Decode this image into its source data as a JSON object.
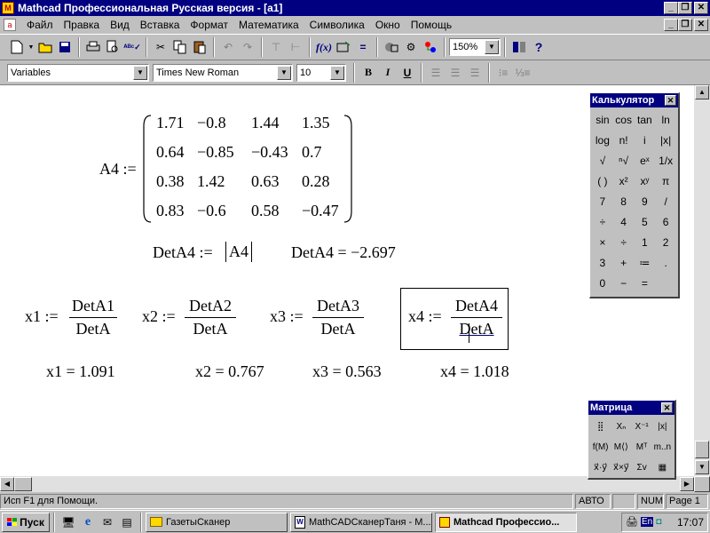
{
  "window": {
    "title": "Mathcad Профессиональная Русская версия - [a1]",
    "app_icon": "mathcad-logo-icon",
    "buttons": [
      "_",
      "❐",
      "✕"
    ],
    "doc_buttons": [
      "_",
      "❐",
      "✕"
    ]
  },
  "menu": [
    "Файл",
    "Правка",
    "Вид",
    "Вставка",
    "Формат",
    "Математика",
    "Символика",
    "Окно",
    "Помощь"
  ],
  "toolbar": {
    "zoom": "150%"
  },
  "format_bar": {
    "style": "Variables",
    "font": "Times New Roman",
    "size": "10",
    "bold": "B",
    "italic": "I",
    "underline": "U"
  },
  "worksheet": {
    "a4_label": "A4 :=",
    "a4_rows": [
      [
        "1.71",
        "−0.8",
        "1.44",
        "1.35"
      ],
      [
        "0.64",
        "−0.85",
        "−0.43",
        "0.7"
      ],
      [
        "0.38",
        "1.42",
        "0.63",
        "0.28"
      ],
      [
        "0.83",
        "−0.6",
        "0.58",
        "−0.47"
      ]
    ],
    "det_def_label": "DetA4 :=",
    "det_def_arg": "A4",
    "det_result": "DetA4 = −2.697",
    "fractions": [
      {
        "lhs": "x1 :=",
        "num": "DetA1",
        "den": "DetA"
      },
      {
        "lhs": "x2 :=",
        "num": "DetA2",
        "den": "DetA"
      },
      {
        "lhs": "x3 :=",
        "num": "DetA3",
        "den": "DetA"
      },
      {
        "lhs": "x4 :=",
        "num": "DetA4",
        "den": "DetA"
      }
    ],
    "results": [
      "x1 = 1.091",
      "x2 = 0.767",
      "x3 = 0.563",
      "x4 = 1.018"
    ]
  },
  "calculator": {
    "title": "Калькулятор",
    "close": "✕",
    "keys": [
      "sin",
      "cos",
      "tan",
      "ln",
      "log",
      "n!",
      "i",
      "|x|",
      "√",
      "ⁿ√",
      "eˣ",
      "1/x",
      "( )",
      "x²",
      "xʸ",
      "π",
      "7",
      "8",
      "9",
      "/",
      "÷",
      "4",
      "5",
      "6",
      "×",
      "÷",
      "1",
      "2",
      "3",
      "+",
      "≔",
      ".",
      "0",
      "−",
      "=",
      ""
    ]
  },
  "matrix_palette": {
    "title": "Матрица",
    "close": "✕",
    "keys": [
      "⣿",
      "Xₙ",
      "X⁻¹",
      "|x|",
      "f(M)",
      "M⟨⟩",
      "Mᵀ",
      "m..n",
      "x⃗·y⃗",
      "x⃗×y⃗",
      "Σv",
      "▦"
    ]
  },
  "status": {
    "hint": "Исп F1 для Помощи.",
    "mode": "АВТО",
    "num": "NUM",
    "page": "Page 1"
  },
  "taskbar": {
    "start": "Пуск",
    "tasks": [
      "ГазетыСканер",
      "MathCADСканерТаня - M...",
      "Mathcad Профессио..."
    ],
    "lang": "En",
    "clock": "17:07"
  },
  "colors": {
    "title_bg": "#000080",
    "face": "#c0c0c0",
    "work_bg": "#ffffff"
  }
}
